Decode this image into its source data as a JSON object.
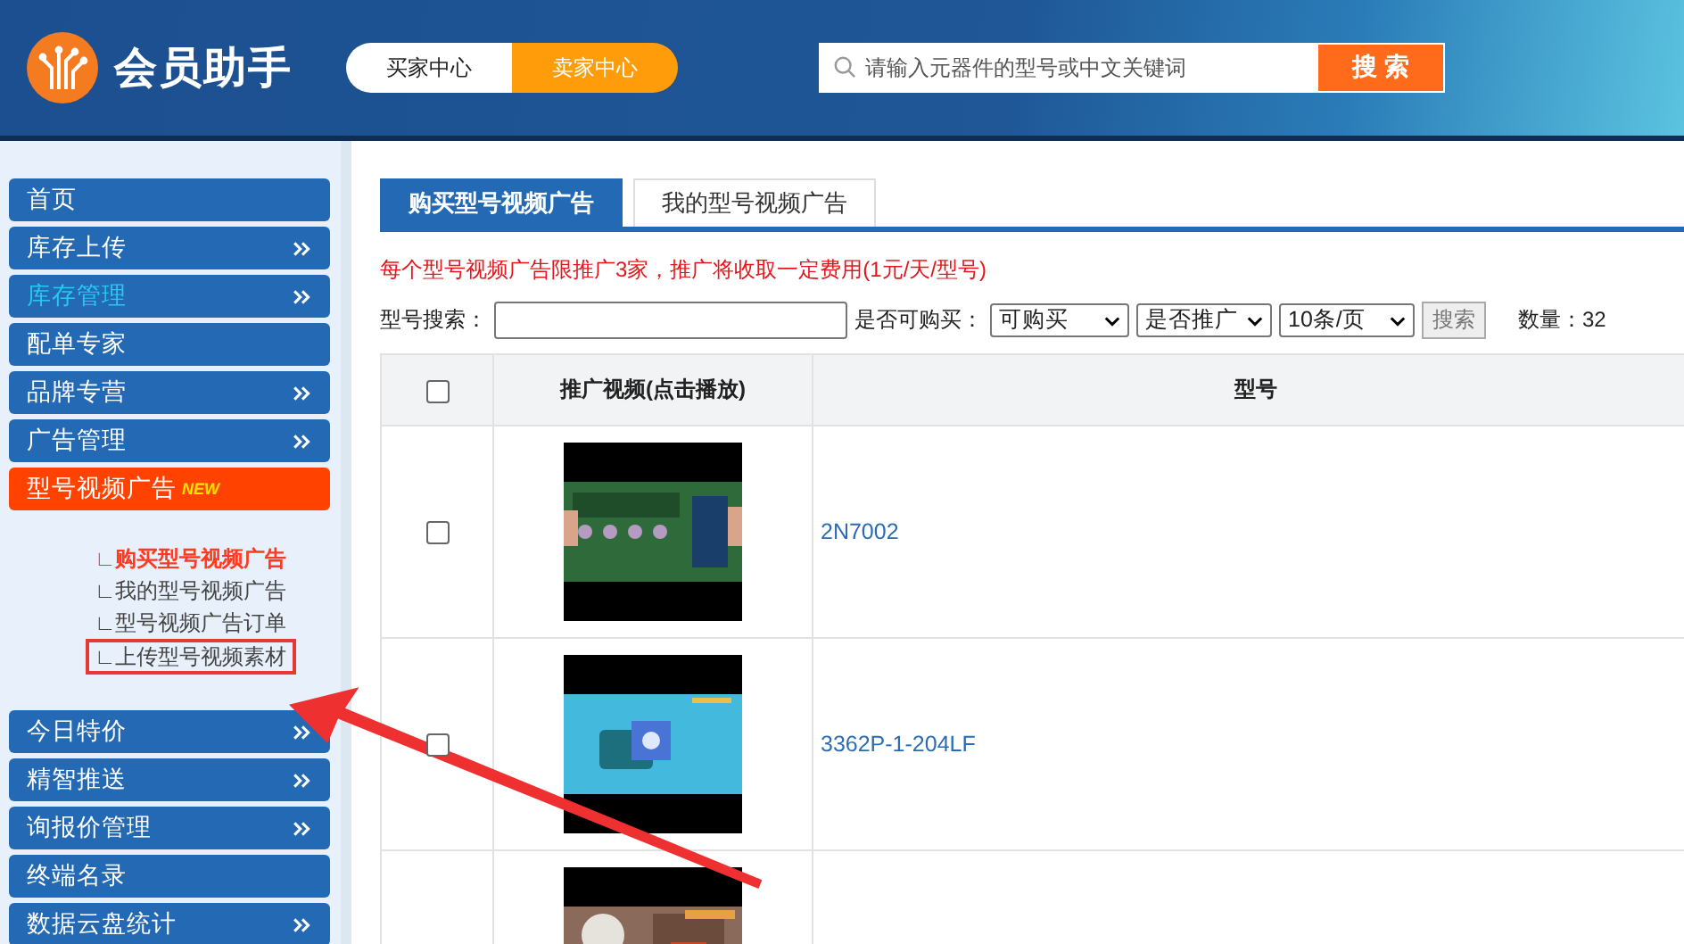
{
  "header": {
    "title": "会员助手",
    "switch": [
      {
        "label": "买家中心",
        "selected": false
      },
      {
        "label": "卖家中心",
        "selected": true
      }
    ],
    "search": {
      "placeholder": "请输入元器件的型号或中文关键词",
      "button": "搜 索"
    }
  },
  "sidebar": {
    "items": [
      {
        "label": "首页",
        "expandable": false,
        "selected": false,
        "highlighted": false
      },
      {
        "label": "库存上传",
        "expandable": true,
        "selected": false,
        "highlighted": false
      },
      {
        "label": "库存管理",
        "expandable": true,
        "selected": false,
        "highlighted": true
      },
      {
        "label": "配单专家",
        "expandable": false,
        "selected": false,
        "highlighted": false
      },
      {
        "label": "品牌专营",
        "expandable": true,
        "selected": false,
        "highlighted": false
      },
      {
        "label": "广告管理",
        "expandable": true,
        "selected": false,
        "highlighted": false
      },
      {
        "label": "型号视频广告",
        "badge": "NEW",
        "expandable": false,
        "selected": true,
        "highlighted": false,
        "children": [
          {
            "label": "∟购买型号视频广告",
            "selected": true,
            "boxed": false
          },
          {
            "label": "∟我的型号视频广告",
            "selected": false,
            "boxed": false
          },
          {
            "label": "∟型号视频广告订单",
            "selected": false,
            "boxed": false
          },
          {
            "label": "∟上传型号视频素材",
            "selected": false,
            "boxed": true
          }
        ]
      },
      {
        "label": "今日特价",
        "expandable": true,
        "selected": false,
        "highlighted": false
      },
      {
        "label": "精智推送",
        "expandable": true,
        "selected": false,
        "highlighted": false
      },
      {
        "label": "询报价管理",
        "expandable": true,
        "selected": false,
        "highlighted": false
      },
      {
        "label": "终端名录",
        "expandable": false,
        "selected": false,
        "highlighted": false
      },
      {
        "label": "数据云盘统计",
        "expandable": true,
        "selected": false,
        "highlighted": false
      }
    ]
  },
  "tabs": [
    {
      "label": "购买型号视频广告",
      "selected": true
    },
    {
      "label": "我的型号视频广告",
      "selected": false
    }
  ],
  "notice": "每个型号视频广告限推广3家，推广将收取一定费用(1元/天/型号)",
  "filters": {
    "model_label": "型号搜索：",
    "purchasable_label": "是否可购买：",
    "dropdowns": [
      "可购买",
      "是否推广",
      "10条/页"
    ],
    "button": "搜索",
    "count": "数量：32"
  },
  "table": {
    "columns": [
      "推广视频(点击播放)",
      "型号"
    ],
    "header_checked": false,
    "rows": [
      {
        "checked": false,
        "model": "2N7002"
      },
      {
        "checked": false,
        "model": "3362P-1-204LF"
      },
      {
        "model": ""
      }
    ]
  }
}
